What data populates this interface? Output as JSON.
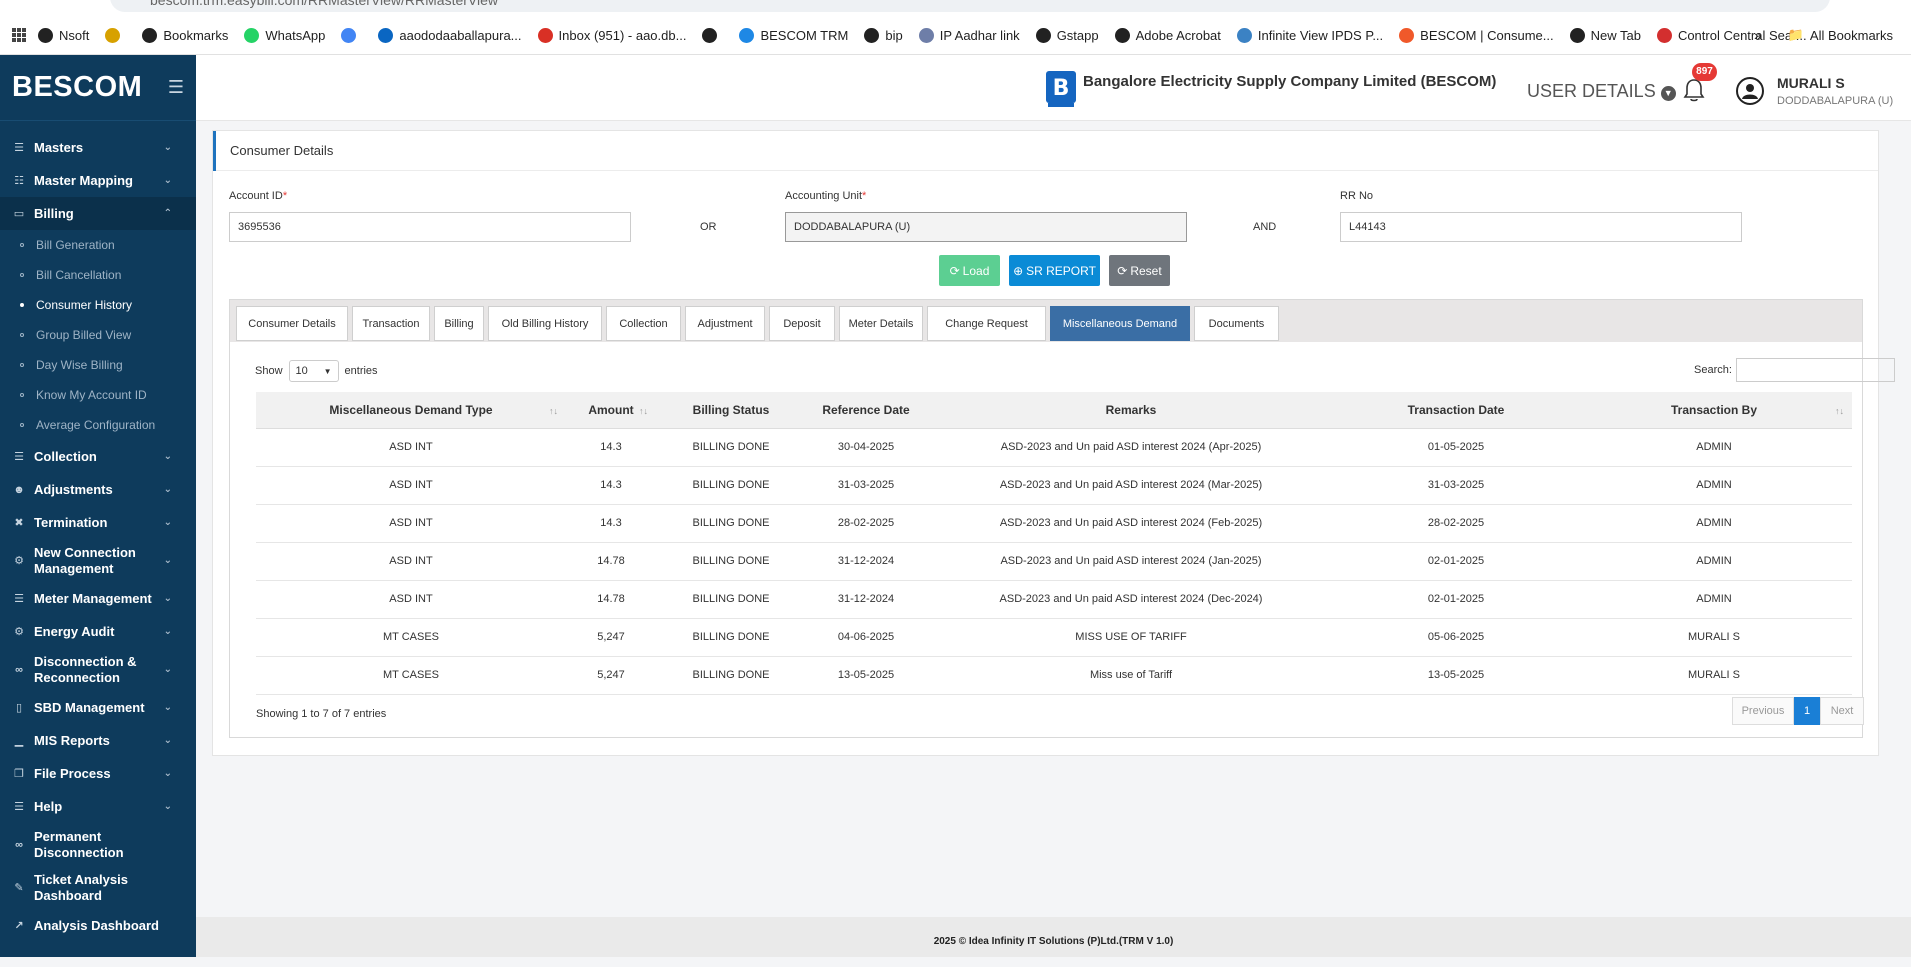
{
  "browser": {
    "url": "bescom.trm.easybill.com/RRMasterView/RRMasterView",
    "bookmarks": [
      {
        "label": "Nsoft",
        "color": "#222"
      },
      {
        "label": "",
        "color": "#d7a100"
      },
      {
        "label": "Bookmarks",
        "color": "#222"
      },
      {
        "label": "WhatsApp",
        "color": "#25d366"
      },
      {
        "label": "",
        "color": "#4285f4"
      },
      {
        "label": "aaododaaballapura...",
        "color": "#0a66c2"
      },
      {
        "label": "Inbox (951) - aao.db...",
        "color": "#d93025"
      },
      {
        "label": "",
        "color": "#222"
      },
      {
        "label": "BESCOM TRM",
        "color": "#1e88e5"
      },
      {
        "label": "bip",
        "color": "#222"
      },
      {
        "label": "IP Aadhar link",
        "color": "#6e7ea8"
      },
      {
        "label": "Gstapp",
        "color": "#222"
      },
      {
        "label": "Adobe Acrobat",
        "color": "#222"
      },
      {
        "label": "Infinite View IPDS P...",
        "color": "#3b82c4"
      },
      {
        "label": "BESCOM | Consume...",
        "color": "#f0592a"
      },
      {
        "label": "New Tab",
        "color": "#222"
      },
      {
        "label": "Control Central Sear...",
        "color": "#d32f2f"
      }
    ],
    "more": "»",
    "all_bookmarks": "All Bookmarks"
  },
  "sidebar": {
    "brand": "BESCOM",
    "menu": [
      {
        "label": "Masters",
        "icon": "list-icon"
      },
      {
        "label": "Master Mapping",
        "icon": "sitemap-icon"
      },
      {
        "label": "Billing",
        "icon": "monitor-icon",
        "open": true,
        "children": [
          "Bill Generation",
          "Bill Cancellation",
          "Consumer History",
          "Group Billed View",
          "Day Wise Billing",
          "Know My Account ID",
          "Average Configuration"
        ]
      },
      {
        "label": "Collection",
        "icon": "list-icon"
      },
      {
        "label": "Adjustments",
        "icon": "users-icon"
      },
      {
        "label": "Termination",
        "icon": "trash-icon"
      },
      {
        "label": "New Connection Management",
        "icon": "gear-icon"
      },
      {
        "label": "Meter Management",
        "icon": "list-icon"
      },
      {
        "label": "Energy Audit",
        "icon": "cogs-icon"
      },
      {
        "label": "Disconnection & Reconnection",
        "icon": "link-icon"
      },
      {
        "label": "SBD Management",
        "icon": "mobile-icon"
      },
      {
        "label": "MIS Reports",
        "icon": "bar-chart-icon"
      },
      {
        "label": "File Process",
        "icon": "file-icon"
      },
      {
        "label": "Help",
        "icon": "list-icon"
      },
      {
        "label": "Permanent Disconnection",
        "icon": "link-icon"
      },
      {
        "label": "Ticket Analysis Dashboard",
        "icon": "pencil-icon"
      },
      {
        "label": "Analysis Dashboard",
        "icon": "line-chart-icon"
      }
    ],
    "current_sub": "Consumer History"
  },
  "header": {
    "company": "Bangalore Electricity Supply Company Limited (BESCOM)",
    "user_details": "USER DETAILS",
    "notification_count": "897",
    "user_name": "MURALI S",
    "user_location": "DODDABALAPURA (U)"
  },
  "form": {
    "title": "Consumer Details",
    "account_id_label": "Account ID",
    "account_id": "3695536",
    "or": "OR",
    "accounting_unit_label": "Accounting Unit",
    "accounting_unit": "DODDABALAPURA (U)",
    "and": "AND",
    "rr_no_label": "RR No",
    "rr_no": "L44143",
    "load": "Load",
    "sr_report": "SR REPORT",
    "reset": "Reset"
  },
  "tabs": [
    "Consumer Details",
    "Transaction",
    "Billing",
    "Old Billing History",
    "Collection",
    "Adjustment",
    "Deposit",
    "Meter Details",
    "Change Request",
    "Miscellaneous Demand",
    "Documents"
  ],
  "active_tab": "Miscellaneous Demand",
  "table": {
    "show": "Show",
    "entries_value": "10",
    "entries": "entries",
    "search": "Search:",
    "columns": [
      "Miscellaneous Demand Type",
      "Amount",
      "Billing Status",
      "Reference Date",
      "Remarks",
      "Transaction Date",
      "Transaction By"
    ],
    "rows": [
      [
        "ASD INT",
        "14.3",
        "BILLING DONE",
        "30-04-2025",
        "ASD-2023 and Un paid ASD interest 2024 (Apr-2025)",
        "01-05-2025",
        "ADMIN"
      ],
      [
        "ASD INT",
        "14.3",
        "BILLING DONE",
        "31-03-2025",
        "ASD-2023 and Un paid ASD interest 2024 (Mar-2025)",
        "31-03-2025",
        "ADMIN"
      ],
      [
        "ASD INT",
        "14.3",
        "BILLING DONE",
        "28-02-2025",
        "ASD-2023 and Un paid ASD interest 2024 (Feb-2025)",
        "28-02-2025",
        "ADMIN"
      ],
      [
        "ASD INT",
        "14.78",
        "BILLING DONE",
        "31-12-2024",
        "ASD-2023 and Un paid ASD interest 2024 (Jan-2025)",
        "02-01-2025",
        "ADMIN"
      ],
      [
        "ASD INT",
        "14.78",
        "BILLING DONE",
        "31-12-2024",
        "ASD-2023 and Un paid ASD interest 2024 (Dec-2024)",
        "02-01-2025",
        "ADMIN"
      ],
      [
        "MT CASES",
        "5,247",
        "BILLING DONE",
        "04-06-2025",
        "MISS USE OF TARIFF",
        "05-06-2025",
        "MURALI S"
      ],
      [
        "MT CASES",
        "5,247",
        "BILLING DONE",
        "13-05-2025",
        "Miss use of Tariff",
        "13-05-2025",
        "MURALI S"
      ]
    ],
    "info": "Showing 1 to 7 of 7 entries",
    "previous": "Previous",
    "page": "1",
    "next": "Next"
  },
  "footer": "2025 © Idea Infinity IT Solutions (P)Ltd.(TRM V 1.0)"
}
